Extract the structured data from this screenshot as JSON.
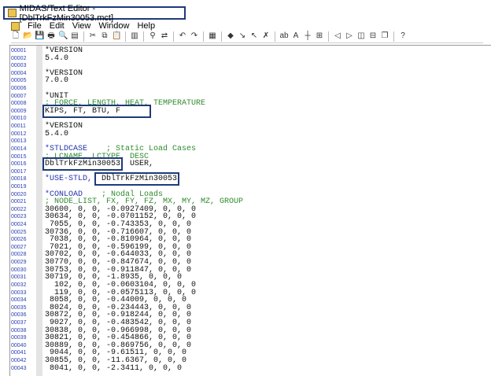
{
  "window": {
    "title": "MIDAS/Text Editor - [DblTrkFzMin30053.mct]"
  },
  "menu": [
    "File",
    "Edit",
    "View",
    "Window",
    "Help"
  ],
  "toolbar": [
    "new-icon",
    "open-icon",
    "save-icon",
    "print-icon",
    "print-preview-icon",
    "page-setup-icon",
    "|",
    "cut-icon",
    "copy-icon",
    "paste-icon",
    "|",
    "column-icon",
    "|",
    "find-icon",
    "replace-icon",
    "|",
    "undo-icon",
    "redo-icon",
    "|",
    "bookmark-icon",
    "|",
    "bookmark-set-icon",
    "bookmark-next-icon",
    "bookmark-prev-icon",
    "bookmark-clear-icon",
    "|",
    "ab-icon",
    "font-icon",
    "split-icon",
    "fit-icon",
    "|",
    "window-back-icon",
    "window-forward-icon",
    "tile-vertical-icon",
    "tile-horizontal-icon",
    "cascade-icon",
    "|",
    "help-icon"
  ],
  "lines": [
    [
      [
        "*VERSION",
        ""
      ]
    ],
    [
      [
        "5.4.0",
        ""
      ]
    ],
    [],
    [
      [
        "*VERSION",
        ""
      ]
    ],
    [
      [
        "7.0.0",
        ""
      ]
    ],
    [],
    [
      [
        "*UNIT",
        ""
      ]
    ],
    [
      [
        "; FORCE, LENGTH, HEAT, TEMPERATURE",
        "cm"
      ]
    ],
    [
      [
        "KIPS, FT, BTU, F      ",
        "hl"
      ]
    ],
    [],
    [
      [
        "*VERSION",
        ""
      ]
    ],
    [
      [
        "5.4.0",
        ""
      ]
    ],
    [],
    [
      [
        "*STLDCASE",
        "kw"
      ],
      [
        "    ; Static Load Cases",
        "cm"
      ]
    ],
    [
      [
        "; LCNAME, LCTYPE, DESC",
        "cm"
      ]
    ],
    [
      [
        "DblTrkFzMin30053",
        "hl"
      ],
      [
        ", USER,",
        ""
      ]
    ],
    [],
    [
      [
        "*USE-STLD,",
        "kw"
      ],
      [
        " ",
        ""
      ],
      [
        " DblTrkFzMin30053",
        "hl"
      ]
    ],
    [],
    [
      [
        "*CONLOAD",
        "kw"
      ],
      [
        "    ; Nodal Loads",
        "cm"
      ]
    ],
    [
      [
        "; NODE_LIST, FX, FY, FZ, MX, MY, MZ, GROUP",
        "cm"
      ]
    ],
    [
      [
        "30600, 0, 0, -0.0927409, 0, 0, 0",
        ""
      ]
    ],
    [
      [
        "30634, 0, 0, -0.0701152, 0, 0, 0",
        ""
      ]
    ],
    [
      [
        " 7055, 0, 0, -0.743353, 0, 0, 0",
        ""
      ]
    ],
    [
      [
        "30736, 0, 0, -0.716607, 0, 0, 0",
        ""
      ]
    ],
    [
      [
        " 7038, 0, 0, -0.810964, 0, 0, 0",
        ""
      ]
    ],
    [
      [
        " 7021, 0, 0, -0.596199, 0, 0, 0",
        ""
      ]
    ],
    [
      [
        "30702, 0, 0, -0.644033, 0, 0, 0",
        ""
      ]
    ],
    [
      [
        "30770, 0, 0, -0.847674, 0, 0, 0",
        ""
      ]
    ],
    [
      [
        "30753, 0, 0, -0.911847, 0, 0, 0",
        ""
      ]
    ],
    [
      [
        "30719, 0, 0, -1.8935, 0, 0, 0",
        ""
      ]
    ],
    [
      [
        "  102, 0, 0, -0.0603104, 0, 0, 0",
        ""
      ]
    ],
    [
      [
        "  119, 0, 0, -0.0575113, 0, 0, 0",
        ""
      ]
    ],
    [
      [
        " 8058, 0, 0, -0.44009, 0, 0, 0",
        ""
      ]
    ],
    [
      [
        " 8024, 0, 0, -0.234443, 0, 0, 0",
        ""
      ]
    ],
    [
      [
        "30872, 0, 0, -0.918244, 0, 0, 0",
        ""
      ]
    ],
    [
      [
        " 9027, 0, 0, -0.483542, 0, 0, 0",
        ""
      ]
    ],
    [
      [
        "30838, 0, 0, -0.966998, 0, 0, 0",
        ""
      ]
    ],
    [
      [
        "30821, 0, 0, -0.454866, 0, 0, 0",
        ""
      ]
    ],
    [
      [
        "30889, 0, 0, -0.869756, 0, 0, 0",
        ""
      ]
    ],
    [
      [
        " 9044, 0, 0, -9.61511, 0, 0, 0",
        ""
      ]
    ],
    [
      [
        "30855, 0, 0, -11.6367, 0, 0, 0",
        ""
      ]
    ],
    [
      [
        " 8041, 0, 0, -2.3411, 0, 0, 0",
        ""
      ]
    ]
  ]
}
